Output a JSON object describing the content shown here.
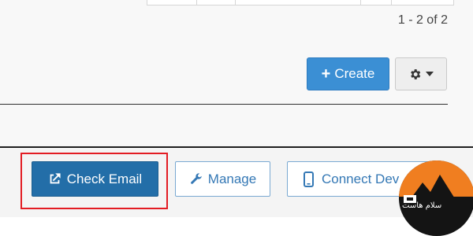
{
  "pagination": {
    "text": "1 - 2 of 2"
  },
  "toolbar": {
    "create_label": "Create",
    "create_icon": "plus-icon",
    "settings_icon": "gear-icon",
    "settings_caret": "caret-down-icon"
  },
  "account_actions": {
    "check_email": {
      "label": "Check Email",
      "icon": "external-link-icon"
    },
    "manage": {
      "label": "Manage",
      "icon": "wrench-icon"
    },
    "connect_devices": {
      "label": "Connect Dev",
      "icon": "mobile-icon"
    }
  },
  "watermark": {
    "text": "سلام هاست"
  },
  "colors": {
    "primary": "#3b8fd4",
    "primary_dark": "#236ea8",
    "outline_text": "#3478b5",
    "highlight": "#e31c23",
    "logo_orange": "#f07e20"
  }
}
